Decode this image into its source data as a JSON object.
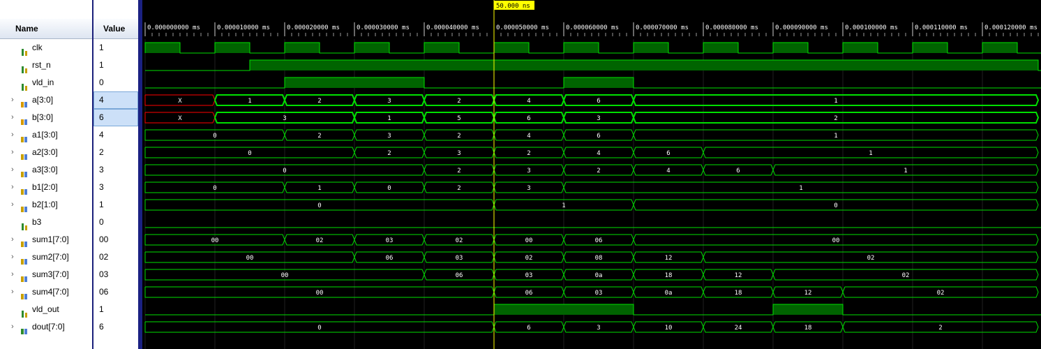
{
  "columns": {
    "name": "Name",
    "value": "Value"
  },
  "cursor": {
    "label": "50.000 ns",
    "time_ns": 50
  },
  "timeline": {
    "ticks": [
      "0.000000000 ms",
      "0.000010000 ms",
      "0.000020000 ms",
      "0.000030000 ms",
      "0.000040000 ms",
      "0.000050000 ms",
      "0.000060000 ms",
      "0.000070000 ms",
      "0.000080000 ms",
      "0.000090000 ms",
      "0.000100000 ms",
      "0.000110000 ms",
      "0.000120000 ms"
    ]
  },
  "colors": {
    "wave": "#00e000",
    "fill": "#006400",
    "xstate": "#ff0000",
    "cursor": "#ffff00",
    "selected": "#cce0f8"
  },
  "signals": [
    {
      "name": "clk",
      "value": "1",
      "kind": "bit",
      "icon": "bit-signal-icon",
      "expand": false,
      "high": [
        [
          0,
          5
        ],
        [
          10,
          15
        ],
        [
          20,
          25
        ],
        [
          30,
          35
        ],
        [
          40,
          45
        ],
        [
          50,
          55
        ],
        [
          60,
          65
        ],
        [
          70,
          75
        ],
        [
          80,
          85
        ],
        [
          90,
          95
        ],
        [
          100,
          105
        ],
        [
          110,
          115
        ],
        [
          120,
          125
        ]
      ]
    },
    {
      "name": "rst_n",
      "value": "1",
      "kind": "bit",
      "icon": "bit-signal-icon",
      "expand": false,
      "high": [
        [
          15,
          128
        ]
      ]
    },
    {
      "name": "vld_in",
      "value": "0",
      "kind": "bit",
      "icon": "bit-signal-icon",
      "expand": false,
      "high": [
        [
          20,
          40
        ],
        [
          60,
          70
        ]
      ]
    },
    {
      "name": "a[3:0]",
      "value": "4",
      "kind": "bus",
      "icon": "input-bus-icon",
      "expand": true,
      "selected": true,
      "seg": [
        [
          0,
          10,
          "X",
          1
        ],
        [
          10,
          20,
          "1"
        ],
        [
          20,
          30,
          "2"
        ],
        [
          30,
          40,
          "3"
        ],
        [
          40,
          50,
          "2"
        ],
        [
          50,
          60,
          "4"
        ],
        [
          60,
          70,
          "6"
        ],
        [
          70,
          128,
          "1"
        ]
      ]
    },
    {
      "name": "b[3:0]",
      "value": "6",
      "kind": "bus",
      "icon": "input-bus-icon",
      "expand": true,
      "selected": true,
      "seg": [
        [
          0,
          10,
          "X",
          1
        ],
        [
          10,
          30,
          "3"
        ],
        [
          30,
          40,
          "1"
        ],
        [
          40,
          50,
          "5"
        ],
        [
          50,
          60,
          "6"
        ],
        [
          60,
          70,
          "3"
        ],
        [
          70,
          128,
          "2"
        ]
      ]
    },
    {
      "name": "a1[3:0]",
      "value": "4",
      "kind": "bus",
      "icon": "bus-icon",
      "expand": true,
      "seg": [
        [
          0,
          20,
          "0"
        ],
        [
          20,
          30,
          "2"
        ],
        [
          30,
          40,
          "3"
        ],
        [
          40,
          50,
          "2"
        ],
        [
          50,
          60,
          "4"
        ],
        [
          60,
          70,
          "6"
        ],
        [
          70,
          128,
          "1"
        ]
      ]
    },
    {
      "name": "a2[3:0]",
      "value": "2",
      "kind": "bus",
      "icon": "bus-icon",
      "expand": true,
      "seg": [
        [
          0,
          30,
          "0"
        ],
        [
          30,
          40,
          "2"
        ],
        [
          40,
          50,
          "3"
        ],
        [
          50,
          60,
          "2"
        ],
        [
          60,
          70,
          "4"
        ],
        [
          70,
          80,
          "6"
        ],
        [
          80,
          128,
          "1"
        ]
      ]
    },
    {
      "name": "a3[3:0]",
      "value": "3",
      "kind": "bus",
      "icon": "bus-icon",
      "expand": true,
      "seg": [
        [
          0,
          40,
          "0"
        ],
        [
          40,
          50,
          "2"
        ],
        [
          50,
          60,
          "3"
        ],
        [
          60,
          70,
          "2"
        ],
        [
          70,
          80,
          "4"
        ],
        [
          80,
          90,
          "6"
        ],
        [
          90,
          128,
          "1"
        ]
      ]
    },
    {
      "name": "b1[2:0]",
      "value": "3",
      "kind": "bus",
      "icon": "bus-icon",
      "expand": true,
      "seg": [
        [
          0,
          20,
          "0"
        ],
        [
          20,
          30,
          "1"
        ],
        [
          30,
          40,
          "0"
        ],
        [
          40,
          50,
          "2"
        ],
        [
          50,
          60,
          "3"
        ],
        [
          60,
          128,
          "1"
        ]
      ]
    },
    {
      "name": "b2[1:0]",
      "value": "1",
      "kind": "bus",
      "icon": "bus-icon",
      "expand": true,
      "seg": [
        [
          0,
          50,
          "0"
        ],
        [
          50,
          70,
          "1"
        ],
        [
          70,
          128,
          "0"
        ]
      ]
    },
    {
      "name": "b3",
      "value": "0",
      "kind": "bit",
      "icon": "bit-signal-icon",
      "expand": false,
      "high": []
    },
    {
      "name": "sum1[7:0]",
      "value": "00",
      "kind": "bus",
      "icon": "bus-icon",
      "expand": true,
      "seg": [
        [
          0,
          20,
          "00"
        ],
        [
          20,
          30,
          "02"
        ],
        [
          30,
          40,
          "03"
        ],
        [
          40,
          50,
          "02"
        ],
        [
          50,
          60,
          "00"
        ],
        [
          60,
          70,
          "06"
        ],
        [
          70,
          128,
          "00"
        ]
      ]
    },
    {
      "name": "sum2[7:0]",
      "value": "02",
      "kind": "bus",
      "icon": "bus-icon",
      "expand": true,
      "seg": [
        [
          0,
          30,
          "00"
        ],
        [
          30,
          40,
          "06"
        ],
        [
          40,
          50,
          "03"
        ],
        [
          50,
          60,
          "02"
        ],
        [
          60,
          70,
          "08"
        ],
        [
          70,
          80,
          "12"
        ],
        [
          80,
          128,
          "02"
        ]
      ]
    },
    {
      "name": "sum3[7:0]",
      "value": "03",
      "kind": "bus",
      "icon": "bus-icon",
      "expand": true,
      "seg": [
        [
          0,
          40,
          "00"
        ],
        [
          40,
          50,
          "06"
        ],
        [
          50,
          60,
          "03"
        ],
        [
          60,
          70,
          "0a"
        ],
        [
          70,
          80,
          "18"
        ],
        [
          80,
          90,
          "12"
        ],
        [
          90,
          128,
          "02"
        ]
      ]
    },
    {
      "name": "sum4[7:0]",
      "value": "06",
      "kind": "bus",
      "icon": "bus-icon",
      "expand": true,
      "seg": [
        [
          0,
          50,
          "00"
        ],
        [
          50,
          60,
          "06"
        ],
        [
          60,
          70,
          "03"
        ],
        [
          70,
          80,
          "0a"
        ],
        [
          80,
          90,
          "18"
        ],
        [
          90,
          100,
          "12"
        ],
        [
          100,
          128,
          "02"
        ]
      ]
    },
    {
      "name": "vld_out",
      "value": "1",
      "kind": "bit",
      "icon": "bit-signal-icon",
      "expand": false,
      "high": [
        [
          50,
          70
        ],
        [
          90,
          100
        ]
      ]
    },
    {
      "name": "dout[7:0]",
      "value": "6",
      "kind": "bus",
      "icon": "output-bus-icon",
      "expand": true,
      "seg": [
        [
          0,
          50,
          "0"
        ],
        [
          50,
          60,
          "6"
        ],
        [
          60,
          70,
          "3"
        ],
        [
          70,
          80,
          "10"
        ],
        [
          80,
          90,
          "24"
        ],
        [
          90,
          100,
          "18"
        ],
        [
          100,
          128,
          "2"
        ]
      ]
    }
  ]
}
